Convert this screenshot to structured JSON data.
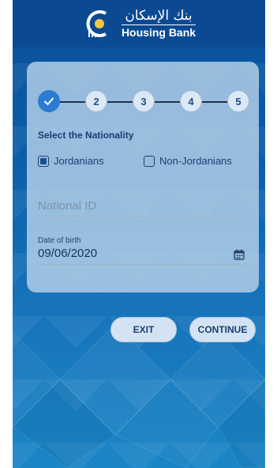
{
  "header": {
    "logo_arabic": "بنك الإسكان",
    "logo_english": "Housing Bank"
  },
  "stepper": {
    "steps": [
      {
        "label": "",
        "state": "completed",
        "icon": "check-icon"
      },
      {
        "label": "2",
        "state": "pending"
      },
      {
        "label": "3",
        "state": "pending"
      },
      {
        "label": "4",
        "state": "pending"
      },
      {
        "label": "5",
        "state": "pending"
      }
    ]
  },
  "form": {
    "nationality_title": "Select the Nationality",
    "options": [
      {
        "label": "Jordanians",
        "checked": true
      },
      {
        "label": "Non-Jordanians",
        "checked": false
      }
    ],
    "national_id_placeholder": "National ID",
    "dob_label": "Date of birth",
    "dob_value": "09/06/2020"
  },
  "buttons": {
    "exit_label": "EXIT",
    "continue_label": "CONTINUE"
  },
  "colors": {
    "brand_blue": "#0b4a93",
    "accent": "#2b7bd1",
    "text_dark": "#153f77"
  }
}
